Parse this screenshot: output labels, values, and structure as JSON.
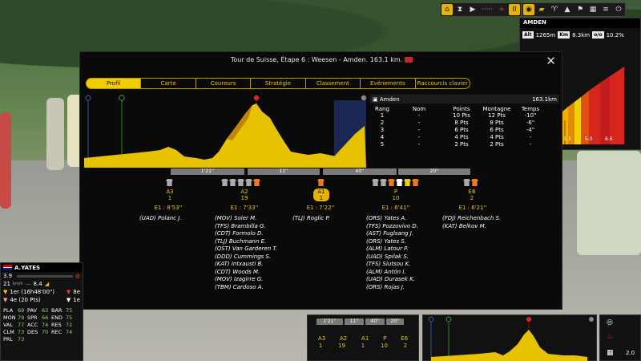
{
  "toolbar": {
    "speed": "II"
  },
  "mini_panel": {
    "title": "AMDEN",
    "alt_label": "Alt",
    "alt_value": "1265m",
    "km_label": "Km",
    "km_value": "8.3km",
    "pct_label": "o/o",
    "pct_value": "10.2%",
    "ticks": [
      "3.3",
      "5.0",
      "6.6"
    ]
  },
  "modal": {
    "title": "Tour de Suisse, Étape 6 : Weesen - Amden. 163.1 km.",
    "close": "✕",
    "tabs": [
      "Profil",
      "Carte",
      "Coureurs",
      "Stratégie",
      "Classement",
      "Evénements",
      "Raccourcis clavier"
    ],
    "active_tab": 0
  },
  "results": {
    "location": "Amden",
    "distance": "163.1km",
    "columns": [
      "Rang",
      "Nom",
      "Points",
      "Montagne",
      "Temps"
    ],
    "rows": [
      [
        "1",
        "-",
        "10 Pts",
        "12 Pts",
        "-10\""
      ],
      [
        "2",
        "-",
        "8 Pts",
        "8 Pts",
        "-6\""
      ],
      [
        "3",
        "-",
        "6 Pts",
        "6 Pts",
        "-4\""
      ],
      [
        "4",
        "-",
        "4 Pts",
        "4 Pts",
        "-"
      ],
      [
        "5",
        "-",
        "2 Pts",
        "2 Pts",
        "-"
      ]
    ]
  },
  "gaps": [
    "1'21''",
    "11''",
    "40''",
    "20''"
  ],
  "groups": [
    {
      "label": "A3",
      "count": "1",
      "time": "E1 : 8'53''",
      "riders": [
        "(UAD) Polanc J."
      ]
    },
    {
      "label": "A2",
      "count": "19",
      "time": "E1 : 7'33''",
      "riders": [
        "(MOV) Soler M.",
        "(TFS) Brambilla G.",
        "(CDT) Formolo D.",
        "(TLJ) Buchmann E.",
        "(QST) Van Garderen T.",
        "(DDD) Cummings S.",
        "(KAT) Intxausti B.",
        "(CDT) Woods M.",
        "(MOV) Izagirre G.",
        "(TBM) Cardoso A."
      ]
    },
    {
      "label": "A1",
      "count": "1",
      "time": "E1 : 7'22''",
      "riders": [
        "(TLJ) Roglic P."
      ]
    },
    {
      "label": "P",
      "count": "10",
      "time": "E1 : 6'41''",
      "riders": [
        "(ORS) Yates A.",
        "(TFS) Pozzovivo D.",
        "(AST) Fuglsang J.",
        "(ORS) Yates S.",
        "(ALM) Latour P.",
        "(UAD) Spilak S.",
        "(TFS) Siutsou K.",
        "(ALM) Antón I.",
        "(UAD) Durasek K.",
        "(ORS) Rojas J."
      ]
    },
    {
      "label": "E6",
      "count": "2",
      "time": "E1 : 6'21''",
      "riders": [
        "(FDJ) Reichenbach S.",
        "(KAT) Belkov M."
      ]
    }
  ],
  "rider": {
    "name": "A.YATES",
    "power": "3.9",
    "heart_icon": "heart-icon",
    "speed": "21",
    "speed_unit": "km/h",
    "effort": "8.4",
    "rank_line_1": "1er (16h48'00\")",
    "rank_code_1": "8e",
    "rank_line_2": "4e (20 Pts)",
    "rank_code_2": "1e",
    "stats": [
      [
        "PLA",
        "69",
        "PAV",
        "63",
        "BAR",
        "75"
      ],
      [
        "MON",
        "79",
        "SPR",
        "66",
        "END",
        "75"
      ],
      [
        "VAL",
        "77",
        "ACC",
        "74",
        "RES",
        "72"
      ],
      [
        "CLM",
        "73",
        "DES",
        "70",
        "REC",
        "74"
      ],
      [
        "PRL",
        "73",
        "",
        "",
        "",
        ""
      ]
    ]
  },
  "bottom_gaps": {
    "gaps": [
      "1'21''",
      "11''",
      "40''",
      "20''"
    ],
    "labels": [
      "A3",
      "A2",
      "A1",
      "P",
      "E6"
    ],
    "counts": [
      "1",
      "19",
      "1",
      "10",
      "2"
    ]
  },
  "right_strip": {
    "value": "2.0"
  },
  "colors": {
    "accent": "#f2cc00",
    "profile_fill": "#e6c200",
    "profile_dark": "#b7760a",
    "climb_red": "#d7261e",
    "sprint_green": "#3cb54a"
  }
}
